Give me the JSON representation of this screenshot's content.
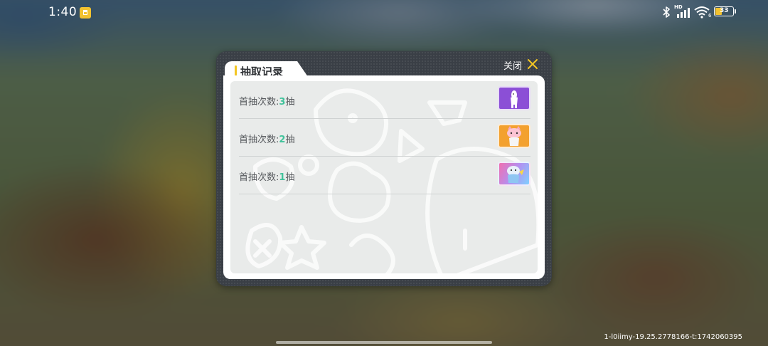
{
  "status_bar": {
    "time": "1:40",
    "network_label": "HD",
    "wifi_label": "6",
    "battery": "33"
  },
  "dialog": {
    "title": "抽取记录",
    "close_label": "关闭",
    "records": [
      {
        "prefix": "首抽次数:",
        "count": "3",
        "suffix": "抽",
        "reward_icon": "white-figure-purple-card",
        "card_color": "#8b4fd6"
      },
      {
        "prefix": "首抽次数:",
        "count": "2",
        "suffix": "抽",
        "reward_icon": "pink-cat-orange-card",
        "card_color": "#f3a12f"
      },
      {
        "prefix": "首抽次数:",
        "count": "1",
        "suffix": "抽",
        "reward_icon": "blue-bird-pink-card",
        "card_color": "#e58fd1"
      }
    ]
  },
  "footer": {
    "build_info": "1-l0iimy-19.25.2778166-t:1742060395"
  },
  "colors": {
    "accent_yellow": "#f3c623",
    "count_green": "#3fc29a",
    "dialog_frame": "#3a3f46"
  }
}
